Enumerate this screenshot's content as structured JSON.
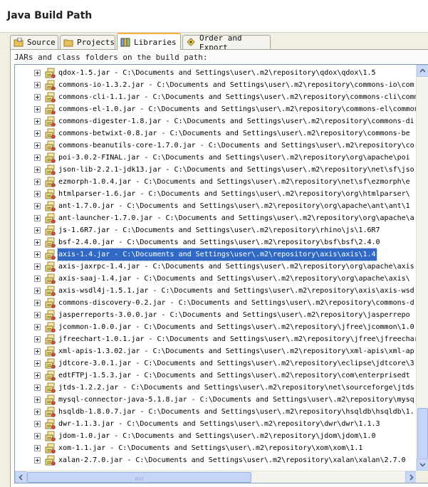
{
  "window": {
    "title": "Java Build Path"
  },
  "tabs": [
    {
      "label": "Source",
      "icon": "source-folder-icon",
      "active": false
    },
    {
      "label": "Projects",
      "icon": "projects-icon",
      "active": false
    },
    {
      "label": "Libraries",
      "icon": "libraries-icon",
      "active": true
    },
    {
      "label": "Order and Export",
      "icon": "order-export-icon",
      "active": false
    }
  ],
  "panel": {
    "label": "JARs and class folders on the build path:"
  },
  "tree": {
    "rows": [
      "qdox-1.5.jar - C:\\Documents and Settings\\user\\.m2\\repository\\qdox\\qdox\\1.5",
      "commons-io-1.3.2.jar - C:\\Documents and Settings\\user\\.m2\\repository\\commons-io\\com",
      "commons-cli-1.1.jar - C:\\Documents and Settings\\user\\.m2\\repository\\commons-cli\\comm",
      "commons-el-1.0.jar - C:\\Documents and Settings\\user\\.m2\\repository\\commons-el\\common",
      "commons-digester-1.8.jar - C:\\Documents and Settings\\user\\.m2\\repository\\commons-di",
      "commons-betwixt-0.8.jar - C:\\Documents and Settings\\user\\.m2\\repository\\commons-be",
      "commons-beanutils-core-1.7.0.jar - C:\\Documents and Settings\\user\\.m2\\repository\\co",
      "poi-3.0.2-FINAL.jar - C:\\Documents and Settings\\user\\.m2\\repository\\org\\apache\\poi",
      "json-lib-2.2.1-jdk13.jar - C:\\Documents and Settings\\user\\.m2\\repository\\net\\sf\\jso",
      "ezmorph-1.0.4.jar - C:\\Documents and Settings\\user\\.m2\\repository\\net\\sf\\ezmorph\\e",
      "htmlparser-1.6.jar - C:\\Documents and Settings\\user\\.m2\\repository\\org\\htmlparser\\",
      "ant-1.7.0.jar - C:\\Documents and Settings\\user\\.m2\\repository\\org\\apache\\ant\\ant\\1",
      "ant-launcher-1.7.0.jar - C:\\Documents and Settings\\user\\.m2\\repository\\org\\apache\\a",
      "js-1.6R7.jar - C:\\Documents and Settings\\user\\.m2\\repository\\rhino\\js\\1.6R7",
      "bsf-2.4.0.jar - C:\\Documents and Settings\\user\\.m2\\repository\\bsf\\bsf\\2.4.0",
      "axis-1.4.jar - C:\\Documents and Settings\\user\\.m2\\repository\\axis\\axis\\1.4",
      "axis-jaxrpc-1.4.jar - C:\\Documents and Settings\\user\\.m2\\repository\\org\\apache\\axis",
      "axis-saaj-1.4.jar - C:\\Documents and Settings\\user\\.m2\\repository\\org\\apache\\axis\\",
      "axis-wsdl4j-1.5.1.jar - C:\\Documents and Settings\\user\\.m2\\repository\\axis\\axis-wsd",
      "commons-discovery-0.2.jar - C:\\Documents and Settings\\user\\.m2\\repository\\commons-d",
      "jasperreports-3.0.0.jar - C:\\Documents and Settings\\user\\.m2\\repository\\jasperrepo",
      "jcommon-1.0.0.jar - C:\\Documents and Settings\\user\\.m2\\repository\\jfree\\jcommon\\1.0",
      "jfreechart-1.0.1.jar - C:\\Documents and Settings\\user\\.m2\\repository\\jfree\\jfreechar",
      "xml-apis-1.3.02.jar - C:\\Documents and Settings\\user\\.m2\\repository\\xml-apis\\xml-ap",
      "jdtcore-3.0.1.jar - C:\\Documents and Settings\\user\\.m2\\repository\\eclipse\\jdtcore\\3",
      "edtFTPj-1.5.3.jar - C:\\Documents and Settings\\user\\.m2\\repository\\com\\enterprisedt",
      "jtds-1.2.2.jar - C:\\Documents and Settings\\user\\.m2\\repository\\net\\sourceforge\\jtds",
      "mysql-connector-java-5.1.8.jar - C:\\Documents and Settings\\user\\.m2\\repository\\mysq",
      "hsqldb-1.8.0.7.jar - C:\\Documents and Settings\\user\\.m2\\repository\\hsqldb\\hsqldb\\1.",
      "dwr-1.1.3.jar - C:\\Documents and Settings\\user\\.m2\\repository\\dwr\\dwr\\1.1.3",
      "jdom-1.0.jar - C:\\Documents and Settings\\user\\.m2\\repository\\jdom\\jdom\\1.0",
      "xom-1.1.jar - C:\\Documents and Settings\\user\\.m2\\repository\\xom\\xom\\1.1",
      "xalan-2.7.0.jar - C:\\Documents and Settings\\user\\.m2\\repository\\xalan\\xalan\\2.7.0"
    ],
    "selected_index": 15,
    "row_icon": "jar-file-icon",
    "expander_icon": "plus-expander-icon"
  },
  "colors": {
    "selection": "#316ac5",
    "active_tab_accent": "#f7b23b",
    "scrollbar": "#c4d5f8"
  }
}
